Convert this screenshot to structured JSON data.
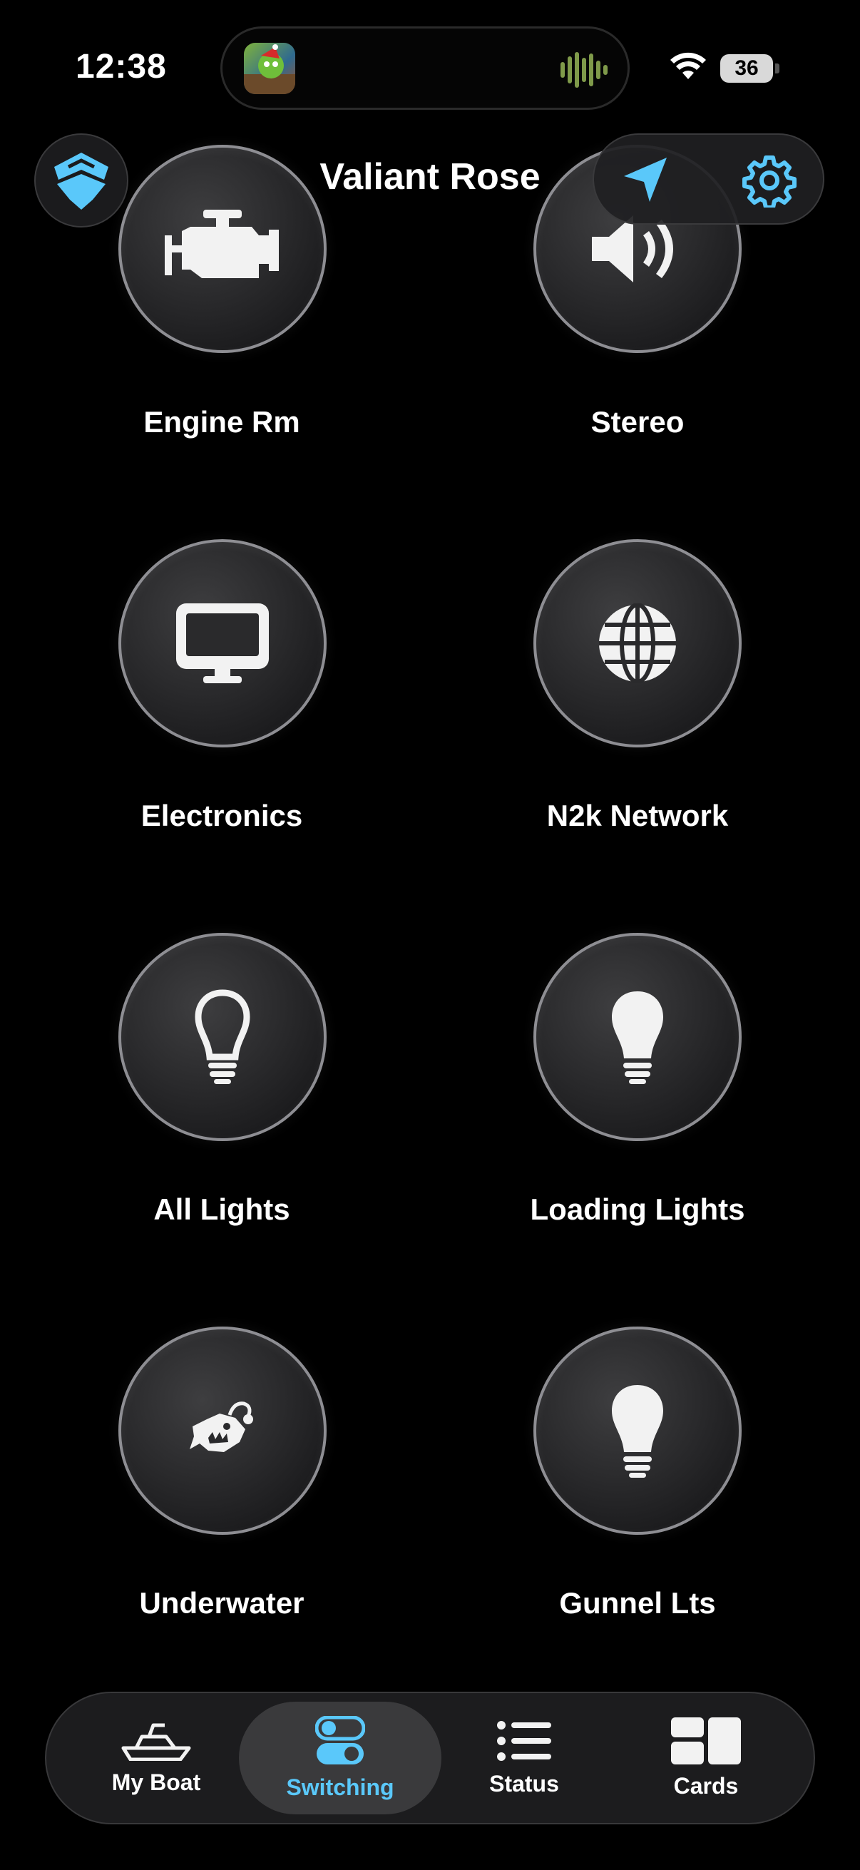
{
  "status_bar": {
    "time": "12:38",
    "battery": "36"
  },
  "header": {
    "title": "Valiant Rose",
    "left_icon": "boat-logo-icon",
    "right_icons": [
      "location-arrow-icon",
      "gear-icon"
    ],
    "accent_color": "#5ac8fa"
  },
  "grid": {
    "items": [
      {
        "label": "Engine Rm",
        "icon": "engine-icon"
      },
      {
        "label": "Stereo",
        "icon": "speaker-icon"
      },
      {
        "label": "Electronics",
        "icon": "monitor-icon"
      },
      {
        "label": "N2k Network",
        "icon": "globe-icon"
      },
      {
        "label": "All Lights",
        "icon": "lightbulb-outline-icon"
      },
      {
        "label": "Loading Lights",
        "icon": "lightbulb-icon"
      },
      {
        "label": "Underwater",
        "icon": "anglerfish-icon"
      },
      {
        "label": "Gunnel Lts",
        "icon": "lightbulb-icon"
      }
    ]
  },
  "tab_bar": {
    "tabs": [
      {
        "label": "My Boat",
        "icon": "boat-icon",
        "active": false
      },
      {
        "label": "Switching",
        "icon": "toggle-switches-icon",
        "active": true
      },
      {
        "label": "Status",
        "icon": "list-icon",
        "active": false
      },
      {
        "label": "Cards",
        "icon": "cards-grid-icon",
        "active": false
      }
    ]
  }
}
